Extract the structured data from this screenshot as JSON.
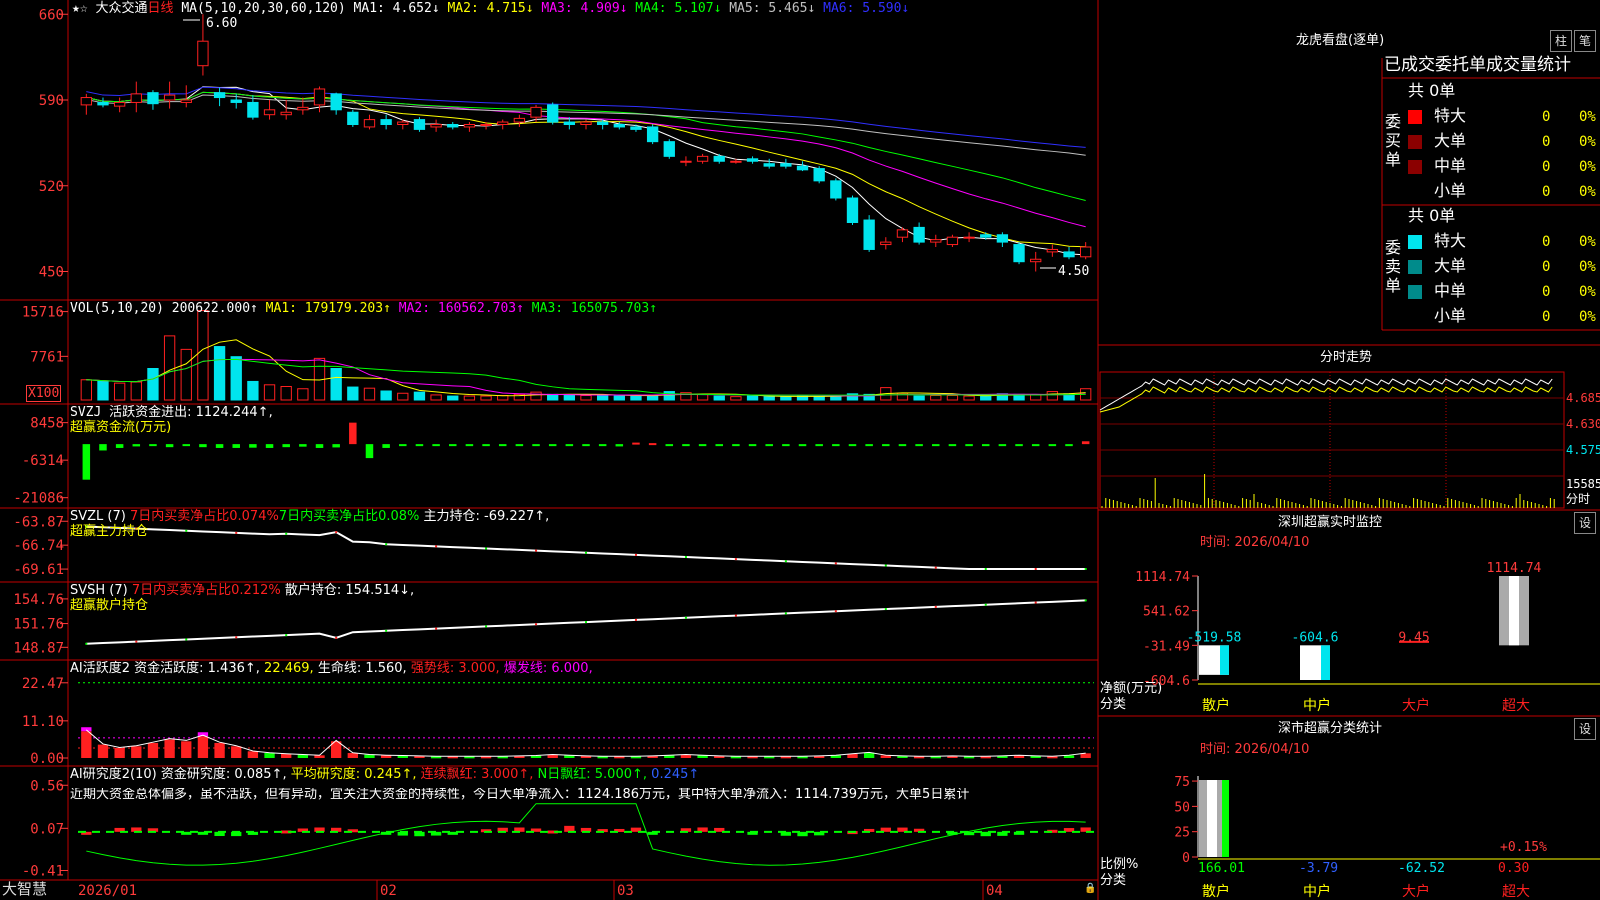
{
  "app": {
    "brand": "大智慧",
    "star_marks": "★☆",
    "security": "大众交通",
    "period": "日线"
  },
  "colors": {
    "up": "#ff2020",
    "down": "#00e5ee",
    "bg": "#000000",
    "grid": "#7a0000",
    "ma1": "#ffffff",
    "ma2": "#ffff00",
    "ma3": "#ff00ff",
    "ma4": "#00ff00",
    "ma5": "#c0c0c0",
    "ma6": "#3030ff"
  },
  "main_header": {
    "ma_params": "MA(5,10,20,30,60,120)",
    "items": [
      {
        "label": "MA1:",
        "value": "4.652↓",
        "color": "#ffffff"
      },
      {
        "label": "MA2:",
        "value": "4.715↓",
        "color": "#ffff00"
      },
      {
        "label": "MA3:",
        "value": "4.909↓",
        "color": "#ff00ff"
      },
      {
        "label": "MA4:",
        "value": "5.107↓",
        "color": "#00ff00"
      },
      {
        "label": "MA5:",
        "value": "5.465↓",
        "color": "#c0c0c0"
      },
      {
        "label": "MA6:",
        "value": "5.590↓",
        "color": "#3030ff"
      }
    ],
    "high_marker": "6.60",
    "low_marker": "4.50"
  },
  "vol_header": {
    "name": "VOL(5,10,20)",
    "value": "200622.000↑",
    "items": [
      {
        "label": "MA1:",
        "value": "179179.203↑",
        "color": "#ffff00"
      },
      {
        "label": "MA2:",
        "value": "160562.703↑",
        "color": "#ff00ff"
      },
      {
        "label": "MA3:",
        "value": "165075.703↑",
        "color": "#00ff00"
      }
    ],
    "unit": "X100"
  },
  "svzj_header": {
    "name": "SVZJ",
    "line1": "活跃资金进出: 1124.244↑,",
    "line2": "超赢资金流(万元)"
  },
  "svzl_header": {
    "name": "SVZL (7)",
    "a": "7日内买卖净占比0.074%",
    "b": "7日内买卖净占比0.08%",
    "c": "主力持仓: -69.227↑,",
    "line2": "超赢主力持仓"
  },
  "svsh_header": {
    "name": "SVSH (7)",
    "a": "7日内买卖净占比0.212%",
    "c": "散户持仓: 154.514↓,",
    "line2": "超赢散户持仓"
  },
  "ai1_header": {
    "name": "AI活跃度2",
    "a": "资金活跃度: 1.436↑,",
    "b": "22.469,",
    "c": "生命线: 1.560,",
    "d": "强势线: 3.000,",
    "e": "爆发线: 6.000,"
  },
  "ai2_header": {
    "name": "AI研究度2(10)",
    "a": "资金研究度: 0.085↑,",
    "b": "平均研究度: 0.245↑,",
    "c": "连续飘红: 3.000↑,",
    "d": "N日飘红: 5.000↑,",
    "e": "0.245↑",
    "comment": "近期大资金总体偏多，虽不活跃，但有异动，宜关注大资金的持续性，今日大单净流入：1124.186万元，其中特大单净流入：1114.739万元，大单5日累计"
  },
  "date_axis": [
    "2026/01",
    "02",
    "03",
    "04"
  ],
  "right": {
    "lhb": {
      "title": "龙虎看盘(逐单)",
      "btn1": "柱",
      "btn2": "笔",
      "subtitle": "已成交委托单成交量统计",
      "buy_label": "委买单",
      "sell_label": "委卖单",
      "total_buy": "共 0单",
      "total_sell": "共 0单",
      "rows": [
        {
          "name": "特大",
          "count": "0",
          "pct": "0%"
        },
        {
          "name": "大单",
          "count": "0",
          "pct": "0%"
        },
        {
          "name": "中单",
          "count": "0",
          "pct": "0%"
        },
        {
          "name": "小单",
          "count": "0",
          "pct": "0%"
        }
      ]
    },
    "fenshi": {
      "title": "分时走势",
      "prices": [
        "4.685",
        "4.630",
        "4.575"
      ],
      "vol": "15585",
      "unit": "分时"
    },
    "sz_monitor": {
      "title": "深圳超赢实时监控",
      "btn": "设",
      "time": "时间: 2026/04/10",
      "ylabels": [
        "1114.74",
        "541.62",
        "-31.49",
        "-604.6"
      ],
      "categories": [
        "散户",
        "中户",
        "大户",
        "超大"
      ],
      "values": [
        -519.58,
        -604.6,
        9.45,
        1114.74
      ],
      "value_labels": [
        "-519.58",
        "-604.6",
        "9.45",
        "1114.74"
      ],
      "side_top": "净额(万元)",
      "side_bottom": "分类"
    },
    "sz_stats": {
      "title": "深市超赢分类统计",
      "btn": "设",
      "time": "时间: 2026/04/10",
      "ylabels": [
        "75",
        "50",
        "25",
        "0"
      ],
      "categories": [
        "散户",
        "中户",
        "大户",
        "超大"
      ],
      "values": [
        "166.01",
        "-3.79",
        "-62.52",
        "0.30"
      ],
      "extra": "+0.15%",
      "side_top": "比例%",
      "side_bottom": "分类"
    }
  },
  "chart_data": [
    {
      "type": "candlestick",
      "title": "大众交通 日线",
      "ylim": [
        4.3,
        6.7
      ],
      "yticks": [
        "660",
        "590",
        "520",
        "450"
      ],
      "x": [
        "2026/01",
        "02",
        "03",
        "04"
      ],
      "series": [
        {
          "name": "K",
          "ohlc": [
            [
              5.86,
              5.95,
              5.78,
              5.92
            ],
            [
              5.88,
              5.92,
              5.84,
              5.86
            ],
            [
              5.85,
              5.92,
              5.8,
              5.88
            ],
            [
              5.88,
              6.05,
              5.8,
              5.95
            ],
            [
              5.96,
              5.98,
              5.82,
              5.87
            ],
            [
              5.9,
              6.05,
              5.83,
              5.94
            ],
            [
              5.88,
              6.02,
              5.84,
              5.9
            ],
            [
              6.18,
              6.6,
              6.1,
              6.38
            ],
            [
              5.96,
              6.0,
              5.85,
              5.92
            ],
            [
              5.9,
              5.95,
              5.83,
              5.88
            ],
            [
              5.88,
              5.94,
              5.74,
              5.76
            ],
            [
              5.78,
              5.9,
              5.74,
              5.82
            ],
            [
              5.78,
              5.9,
              5.74,
              5.8
            ],
            [
              5.82,
              5.92,
              5.78,
              5.84
            ],
            [
              5.86,
              6.01,
              5.8,
              5.99
            ],
            [
              5.95,
              5.96,
              5.78,
              5.82
            ],
            [
              5.8,
              5.82,
              5.68,
              5.7
            ],
            [
              5.68,
              5.78,
              5.66,
              5.74
            ],
            [
              5.74,
              5.78,
              5.66,
              5.7
            ],
            [
              5.7,
              5.74,
              5.66,
              5.72
            ],
            [
              5.74,
              5.76,
              5.64,
              5.66
            ],
            [
              5.68,
              5.74,
              5.64,
              5.7
            ],
            [
              5.7,
              5.72,
              5.66,
              5.68
            ],
            [
              5.68,
              5.72,
              5.64,
              5.7
            ],
            [
              5.7,
              5.72,
              5.66,
              5.7
            ],
            [
              5.7,
              5.74,
              5.66,
              5.72
            ],
            [
              5.72,
              5.78,
              5.68,
              5.75
            ],
            [
              5.76,
              5.86,
              5.72,
              5.84
            ],
            [
              5.86,
              5.88,
              5.7,
              5.72
            ],
            [
              5.72,
              5.76,
              5.66,
              5.7
            ],
            [
              5.7,
              5.74,
              5.66,
              5.72
            ],
            [
              5.72,
              5.74,
              5.66,
              5.7
            ],
            [
              5.7,
              5.72,
              5.66,
              5.68
            ],
            [
              5.68,
              5.7,
              5.64,
              5.66
            ],
            [
              5.68,
              5.7,
              5.54,
              5.56
            ],
            [
              5.56,
              5.58,
              5.42,
              5.44
            ],
            [
              5.4,
              5.44,
              5.36,
              5.4
            ],
            [
              5.4,
              5.46,
              5.38,
              5.44
            ],
            [
              5.44,
              5.46,
              5.38,
              5.4
            ],
            [
              5.4,
              5.42,
              5.38,
              5.4
            ],
            [
              5.42,
              5.44,
              5.38,
              5.4
            ],
            [
              5.38,
              5.42,
              5.34,
              5.36
            ],
            [
              5.38,
              5.42,
              5.34,
              5.36
            ],
            [
              5.36,
              5.4,
              5.32,
              5.33
            ],
            [
              5.34,
              5.36,
              5.22,
              5.24
            ],
            [
              5.24,
              5.26,
              5.08,
              5.1
            ],
            [
              5.1,
              5.12,
              4.88,
              4.9
            ],
            [
              4.92,
              4.96,
              4.66,
              4.68
            ],
            [
              4.72,
              4.78,
              4.68,
              4.74
            ],
            [
              4.78,
              4.86,
              4.74,
              4.84
            ],
            [
              4.86,
              4.9,
              4.72,
              4.74
            ],
            [
              4.74,
              4.8,
              4.7,
              4.76
            ],
            [
              4.72,
              4.8,
              4.7,
              4.78
            ],
            [
              4.78,
              4.82,
              4.74,
              4.78
            ],
            [
              4.8,
              4.82,
              4.76,
              4.78
            ],
            [
              4.8,
              4.82,
              4.7,
              4.74
            ],
            [
              4.72,
              4.74,
              4.56,
              4.58
            ],
            [
              4.58,
              4.66,
              4.5,
              4.6
            ],
            [
              4.66,
              4.72,
              4.62,
              4.68
            ],
            [
              4.66,
              4.7,
              4.6,
              4.62
            ],
            [
              4.62,
              4.74,
              4.6,
              4.7
            ]
          ]
        }
      ]
    },
    {
      "type": "bar",
      "title": "VOL(5,10,20)",
      "yticks": [
        "15716",
        "7761"
      ],
      "unit": "X100",
      "ymax": 16000,
      "values": [
        3600,
        3300,
        3000,
        3200,
        5600,
        11400,
        9000,
        15900,
        9500,
        7700,
        3300,
        2700,
        2400,
        2000,
        7400,
        5600,
        2300,
        2100,
        1600,
        1200,
        1400,
        900,
        700,
        700,
        700,
        800,
        1000,
        1400,
        1000,
        900,
        800,
        900,
        700,
        700,
        800,
        1500,
        1300,
        1000,
        700,
        600,
        700,
        600,
        600,
        700,
        600,
        800,
        1100,
        1000,
        2200,
        1200,
        700,
        800,
        800,
        700,
        800,
        1100,
        1000,
        900,
        1500,
        1100,
        2006
      ]
    },
    {
      "type": "bar",
      "title": "SVZJ",
      "yticks": [
        "8458",
        "-6314",
        "-21086"
      ],
      "ylim": [
        -22000,
        9500
      ],
      "values": [
        -14000,
        -2500,
        -1500,
        -900,
        -700,
        -1200,
        -300,
        -1200,
        -1500,
        -1500,
        -1400,
        -1500,
        -1200,
        -1000,
        -1500,
        -1300,
        8458,
        -5500,
        -1500,
        -600,
        -500,
        -400,
        -300,
        -200,
        -200,
        -150,
        -150,
        -150,
        -150,
        -150,
        -100,
        -100,
        -900,
        600,
        400,
        -300,
        -300,
        -300,
        -300,
        -300,
        -300,
        -300,
        -600,
        -800,
        -300,
        -300,
        -300,
        -300,
        -300,
        -300,
        -300,
        -300,
        -300,
        -300,
        -300,
        -300,
        -300,
        -300,
        -300,
        -600,
        1124
      ]
    },
    {
      "type": "line",
      "title": "SVZL",
      "yticks": [
        "-63.87",
        "-66.74",
        "-69.61"
      ],
      "ylim": [
        -70.2,
        -63.0
      ]
    },
    {
      "type": "line",
      "title": "SVSH",
      "yticks": [
        "154.76",
        "151.76",
        "148.87"
      ],
      "ylim": [
        148.3,
        155.6
      ]
    },
    {
      "type": "bar",
      "title": "AI活跃度2",
      "yticks": [
        "22.47",
        "11.10",
        "0.00"
      ],
      "ylim": [
        0,
        24.5
      ]
    },
    {
      "type": "bar",
      "title": "AI研究度2",
      "yticks": [
        "0.56",
        "0.07",
        "-0.41"
      ],
      "ylim": [
        -0.45,
        0.62
      ]
    },
    {
      "type": "bar",
      "title": "深圳超赢实时监控",
      "categories": [
        "散户",
        "中户",
        "大户",
        "超大"
      ],
      "values": [
        -519.58,
        -604.6,
        9.45,
        1114.74
      ],
      "ylim": [
        -604.6,
        1114.74
      ]
    },
    {
      "type": "bar",
      "title": "深市超赢分类统计",
      "categories": [
        "散户",
        "中户",
        "大户",
        "超大"
      ],
      "values": [
        166.01,
        -3.79,
        -62.52,
        0.3
      ],
      "ylim": [
        0,
        80
      ]
    }
  ]
}
